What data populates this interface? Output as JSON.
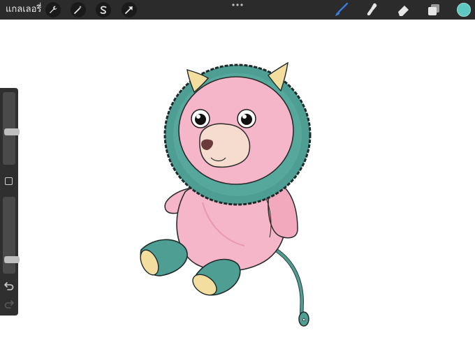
{
  "topbar": {
    "gallery_label": "แกลเลอรี่",
    "left_tools": [
      "wrench-icon",
      "magic-wand-icon",
      "selection-s-icon",
      "transform-arrow-icon"
    ],
    "right_tools": [
      "brush-icon",
      "smudge-icon",
      "eraser-icon",
      "layers-icon"
    ],
    "active_tool": "brush-icon",
    "active_color": "#5ec9c2"
  },
  "sidebar": {
    "brush_size_level": 0.45,
    "opacity_level": 0.15,
    "buttons": [
      "modify-square",
      "undo-icon",
      "redo-icon"
    ]
  },
  "colors": {
    "accent_blue": "#3b7bdc",
    "body_pink": "#f4b6c8",
    "mane_teal": "#4f9e93",
    "horn_cream": "#f3dea0"
  }
}
